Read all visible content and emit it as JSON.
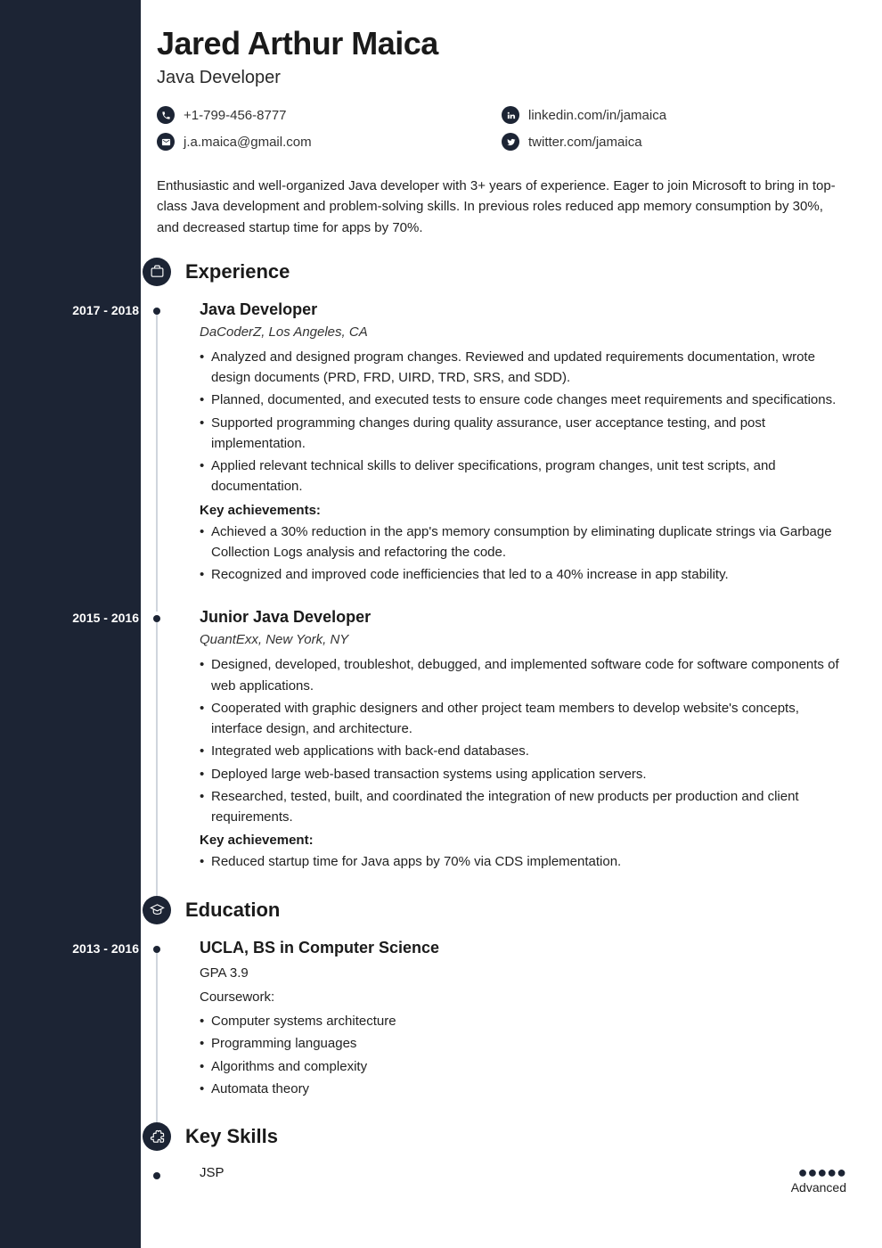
{
  "header": {
    "name": "Jared Arthur Maica",
    "title": "Java Developer"
  },
  "contacts": {
    "phone": "+1-799-456-8777",
    "email": "j.a.maica@gmail.com",
    "linkedin": "linkedin.com/in/jamaica",
    "twitter": "twitter.com/jamaica"
  },
  "summary": "Enthusiastic and well-organized Java developer with 3+ years of experience. Eager to join Microsoft to bring in top-class Java development and problem-solving skills. In previous roles reduced app memory consumption by 30%, and decreased startup time for apps by 70%.",
  "sections": {
    "experience_title": "Experience",
    "education_title": "Education",
    "skills_title": "Key Skills"
  },
  "experience": [
    {
      "date": "2017 - 2018",
      "title": "Java Developer",
      "subtitle": "DaCoderZ, Los Angeles, CA",
      "bullets": [
        "Analyzed and designed program changes. Reviewed and updated requirements documentation, wrote design documents (PRD, FRD, UIRD, TRD, SRS, and SDD).",
        "Planned, documented, and executed tests to ensure code changes meet requirements and specifications.",
        "Supported programming changes during quality assurance, user acceptance testing, and post implementation.",
        "Applied relevant technical skills to deliver specifications, program changes, unit test scripts, and documentation."
      ],
      "key_label": "Key achievements:",
      "key_bullets": [
        "Achieved a 30% reduction in the app's memory consumption by eliminating duplicate strings via Garbage Collection Logs analysis and refactoring the code.",
        "Recognized and improved code inefficiencies that led to a 40% increase in app stability."
      ]
    },
    {
      "date": "2015 - 2016",
      "title": "Junior Java Developer",
      "subtitle": "QuantExx, New York, NY",
      "bullets": [
        "Designed, developed, troubleshot, debugged, and implemented software code for software components of web applications.",
        "Cooperated with graphic designers and other project team members to develop website's concepts, interface design, and architecture.",
        "Integrated web applications with back-end databases.",
        "Deployed large web-based transaction systems using application servers.",
        "Researched, tested, built, and coordinated the integration of new products per production and client requirements."
      ],
      "key_label": "Key achievement:",
      "key_bullets": [
        "Reduced startup time for Java apps by 70% via CDS implementation."
      ]
    }
  ],
  "education": [
    {
      "date": "2013 - 2016",
      "title": "UCLA, BS in Computer Science",
      "gpa": "GPA 3.9",
      "coursework_label": "Coursework:",
      "courses": [
        "Computer systems architecture",
        "Programming languages",
        "Algorithms and complexity",
        "Automata theory"
      ]
    }
  ],
  "skills": [
    {
      "name": "JSP",
      "level": "Advanced",
      "rating": 5
    }
  ]
}
